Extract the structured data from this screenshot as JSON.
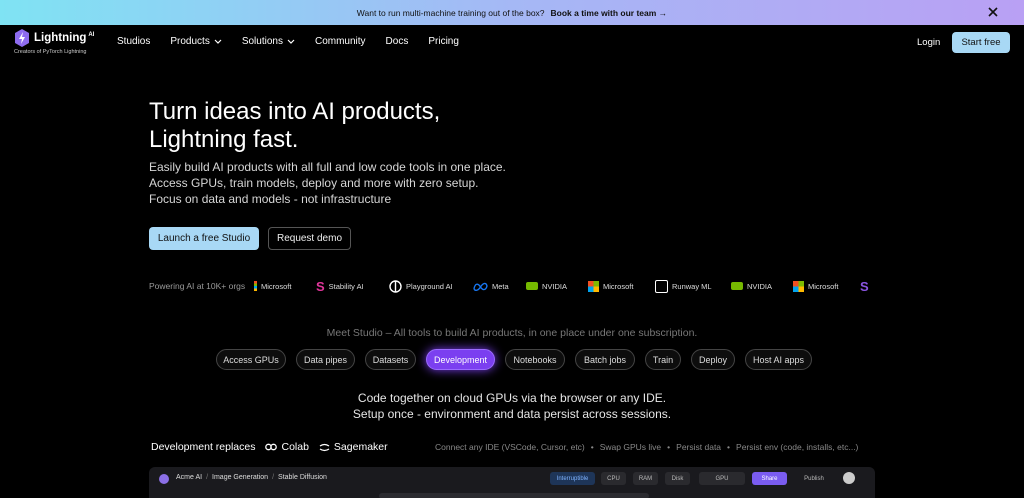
{
  "announcement": {
    "text": "Want to run multi-machine training out of the box?",
    "cta": "Book a time with our team →"
  },
  "logo": {
    "name": "Lightning",
    "sup": "AI",
    "tagline": "Creators of PyTorch Lightning"
  },
  "nav": {
    "links": [
      "Studios",
      "Products",
      "Solutions",
      "Community",
      "Docs",
      "Pricing"
    ],
    "login": "Login",
    "start_free": "Start free"
  },
  "hero": {
    "title_line1": "Turn ideas into AI products,",
    "title_line2": "Lightning fast.",
    "desc_line1": "Easily build AI products with all full and low code tools in one place.",
    "desc_line2": "Access GPUs, train models, deploy and more with zero setup.",
    "desc_line3": "Focus on data and models - not infrastructure",
    "primary_cta": "Launch a free Studio",
    "secondary_cta": "Request demo"
  },
  "powering": "Powering AI at 10K+ orgs",
  "logos": [
    "Microsoft",
    "Stability AI",
    "Playground AI",
    "Meta",
    "NVIDIA",
    "Microsoft",
    "Runway ML",
    "NVIDIA",
    "Microsoft",
    "S"
  ],
  "meet": "Meet Studio – All tools to build AI products, in one place under one subscription.",
  "tabs": [
    "Access GPUs",
    "Data pipes",
    "Datasets",
    "Development",
    "Notebooks",
    "Batch jobs",
    "Train",
    "Deploy",
    "Host AI apps"
  ],
  "active_tab": "Development",
  "dev": {
    "line1": "Code together on cloud GPUs via the browser or any IDE.",
    "line2": "Setup once - environment and data persist across sessions.",
    "replaces_label": "Development replaces",
    "replaces": [
      "Colab",
      "Sagemaker"
    ],
    "features": [
      "Connect any IDE (VSCode, Cursor, etc)",
      "Swap GPUs live",
      "Persist data",
      "Persist env (code, installs, etc...)"
    ],
    "separator": "•"
  },
  "preview": {
    "crumbs": [
      "Acme AI",
      "Image Generation",
      "Stable Diffusion"
    ],
    "crumb_sep": "/",
    "interruptible": "Interruptible",
    "stats": [
      "CPU",
      "RAM",
      "Disk",
      "GPU"
    ],
    "share": "Share",
    "publish": "Publish"
  }
}
